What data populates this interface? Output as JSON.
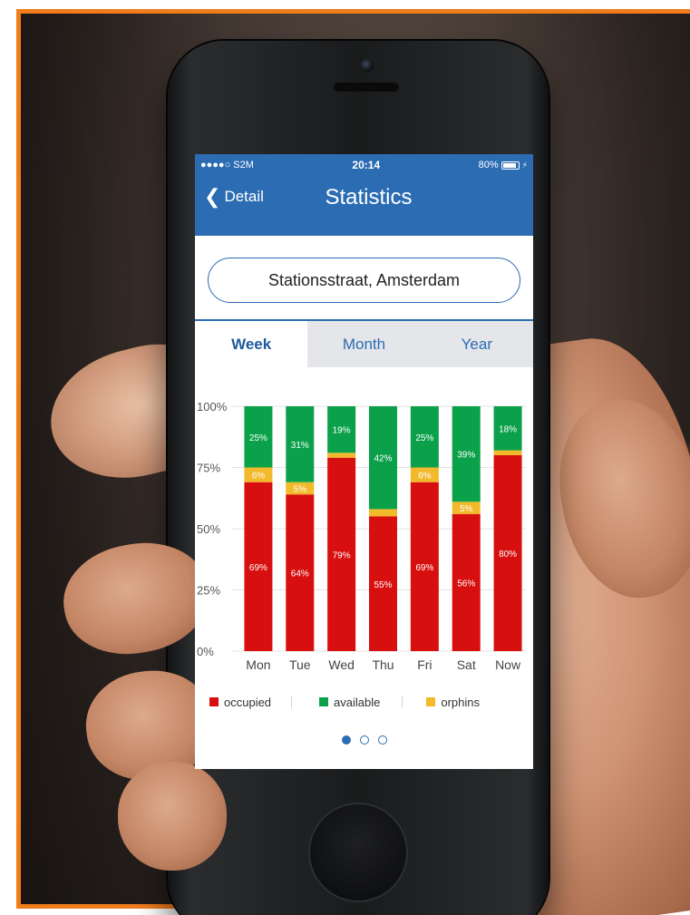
{
  "status_bar": {
    "carrier": "●●●●○ S2M",
    "time": "20:14",
    "battery": "80%"
  },
  "nav": {
    "back_label": "Detail",
    "title": "Statistics"
  },
  "location": "Stationsstraat, Amsterdam",
  "tabs": [
    {
      "label": "Week",
      "active": true
    },
    {
      "label": "Month",
      "active": false
    },
    {
      "label": "Year",
      "active": false
    }
  ],
  "colors": {
    "accent": "#2b6cb3",
    "occupied": "#d80f0f",
    "available": "#0aa14a",
    "orphins": "#f2b92b",
    "frame": "#f07c1c"
  },
  "chart_data": {
    "type": "bar",
    "stacked": true,
    "categories": [
      "Mon",
      "Tue",
      "Wed",
      "Thu",
      "Fri",
      "Sat",
      "Now"
    ],
    "ytick_labels": [
      "0%",
      "25%",
      "50%",
      "75%",
      "100%"
    ],
    "ylim": [
      0,
      100
    ],
    "series": [
      {
        "name": "occupied",
        "values": [
          69,
          64,
          79,
          55,
          69,
          56,
          80
        ],
        "labels": [
          "69%",
          "64%",
          "79%",
          "55%",
          "69%",
          "56%",
          "80%"
        ]
      },
      {
        "name": "orphins",
        "values": [
          6,
          5,
          2,
          3,
          6,
          5,
          2
        ],
        "labels": [
          "6%",
          "5%",
          "",
          "",
          "6%",
          "5%",
          ""
        ]
      },
      {
        "name": "available",
        "values": [
          25,
          31,
          19,
          42,
          25,
          39,
          18
        ],
        "labels": [
          "25%",
          "31%",
          "19%",
          "42%",
          "25%",
          "39%",
          "18%"
        ]
      }
    ],
    "grid": true
  },
  "legend": [
    {
      "label": "occupied"
    },
    {
      "label": "available"
    },
    {
      "label": "orphins"
    }
  ],
  "pager": {
    "count": 3,
    "active_index": 0
  }
}
